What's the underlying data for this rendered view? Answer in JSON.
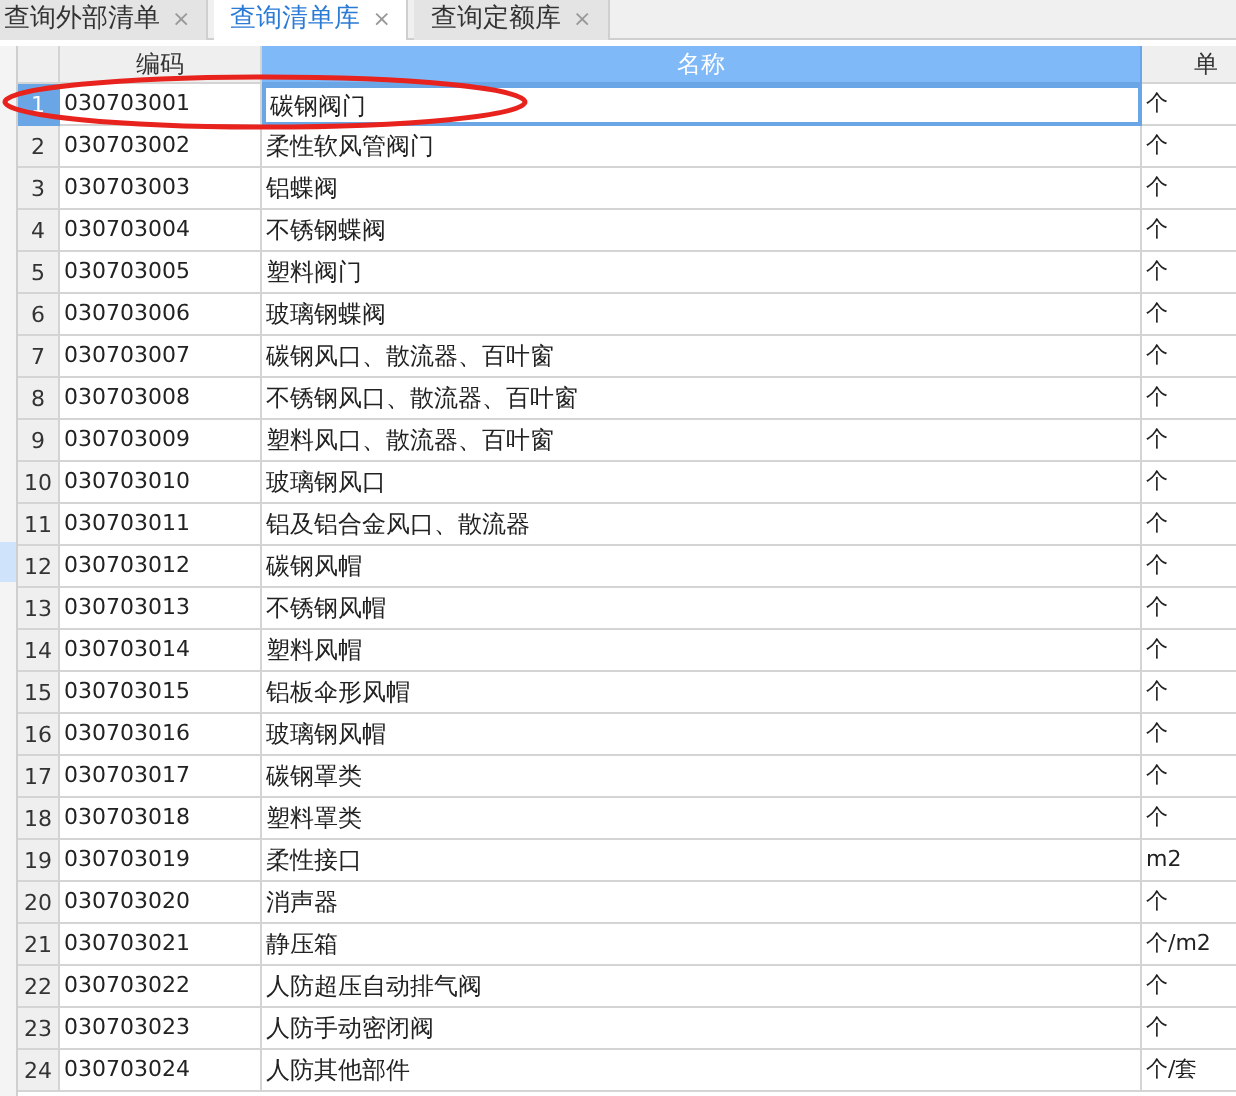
{
  "tabs": [
    {
      "label": "查询外部清单",
      "close": "×",
      "selected": false
    },
    {
      "label": "查询清单库",
      "close": "×",
      "selected": true
    },
    {
      "label": "查询定额库",
      "close": "×",
      "selected": false
    }
  ],
  "table": {
    "columns": [
      {
        "label": "编码",
        "selected": false
      },
      {
        "label": "名称",
        "selected": true
      },
      {
        "label": "单",
        "selected": false
      }
    ],
    "rows": [
      {
        "index": "1",
        "code": "030703001",
        "name": "碳钢阀门",
        "unit": "个",
        "selected": true
      },
      {
        "index": "2",
        "code": "030703002",
        "name": "柔性软风管阀门",
        "unit": "个",
        "selected": false
      },
      {
        "index": "3",
        "code": "030703003",
        "name": "铝蝶阀",
        "unit": "个",
        "selected": false
      },
      {
        "index": "4",
        "code": "030703004",
        "name": "不锈钢蝶阀",
        "unit": "个",
        "selected": false
      },
      {
        "index": "5",
        "code": "030703005",
        "name": "塑料阀门",
        "unit": "个",
        "selected": false
      },
      {
        "index": "6",
        "code": "030703006",
        "name": "玻璃钢蝶阀",
        "unit": "个",
        "selected": false
      },
      {
        "index": "7",
        "code": "030703007",
        "name": "碳钢风口、散流器、百叶窗",
        "unit": "个",
        "selected": false
      },
      {
        "index": "8",
        "code": "030703008",
        "name": "不锈钢风口、散流器、百叶窗",
        "unit": "个",
        "selected": false
      },
      {
        "index": "9",
        "code": "030703009",
        "name": "塑料风口、散流器、百叶窗",
        "unit": "个",
        "selected": false
      },
      {
        "index": "10",
        "code": "030703010",
        "name": "玻璃钢风口",
        "unit": "个",
        "selected": false
      },
      {
        "index": "11",
        "code": "030703011",
        "name": "铝及铝合金风口、散流器",
        "unit": "个",
        "selected": false
      },
      {
        "index": "12",
        "code": "030703012",
        "name": "碳钢风帽",
        "unit": "个",
        "selected": false
      },
      {
        "index": "13",
        "code": "030703013",
        "name": "不锈钢风帽",
        "unit": "个",
        "selected": false
      },
      {
        "index": "14",
        "code": "030703014",
        "name": "塑料风帽",
        "unit": "个",
        "selected": false
      },
      {
        "index": "15",
        "code": "030703015",
        "name": "铝板伞形风帽",
        "unit": "个",
        "selected": false
      },
      {
        "index": "16",
        "code": "030703016",
        "name": "玻璃钢风帽",
        "unit": "个",
        "selected": false
      },
      {
        "index": "17",
        "code": "030703017",
        "name": "碳钢罩类",
        "unit": "个",
        "selected": false
      },
      {
        "index": "18",
        "code": "030703018",
        "name": "塑料罩类",
        "unit": "个",
        "selected": false
      },
      {
        "index": "19",
        "code": "030703019",
        "name": "柔性接口",
        "unit": "m2",
        "selected": false
      },
      {
        "index": "20",
        "code": "030703020",
        "name": "消声器",
        "unit": "个",
        "selected": false
      },
      {
        "index": "21",
        "code": "030703021",
        "name": "静压箱",
        "unit": "个/m2",
        "selected": false
      },
      {
        "index": "22",
        "code": "030703022",
        "name": "人防超压自动排气阀",
        "unit": "个",
        "selected": false
      },
      {
        "index": "23",
        "code": "030703023",
        "name": "人防手动密闭阀",
        "unit": "个",
        "selected": false
      },
      {
        "index": "24",
        "code": "030703024",
        "name": "人防其他部件",
        "unit": "个/套",
        "selected": false
      }
    ]
  }
}
